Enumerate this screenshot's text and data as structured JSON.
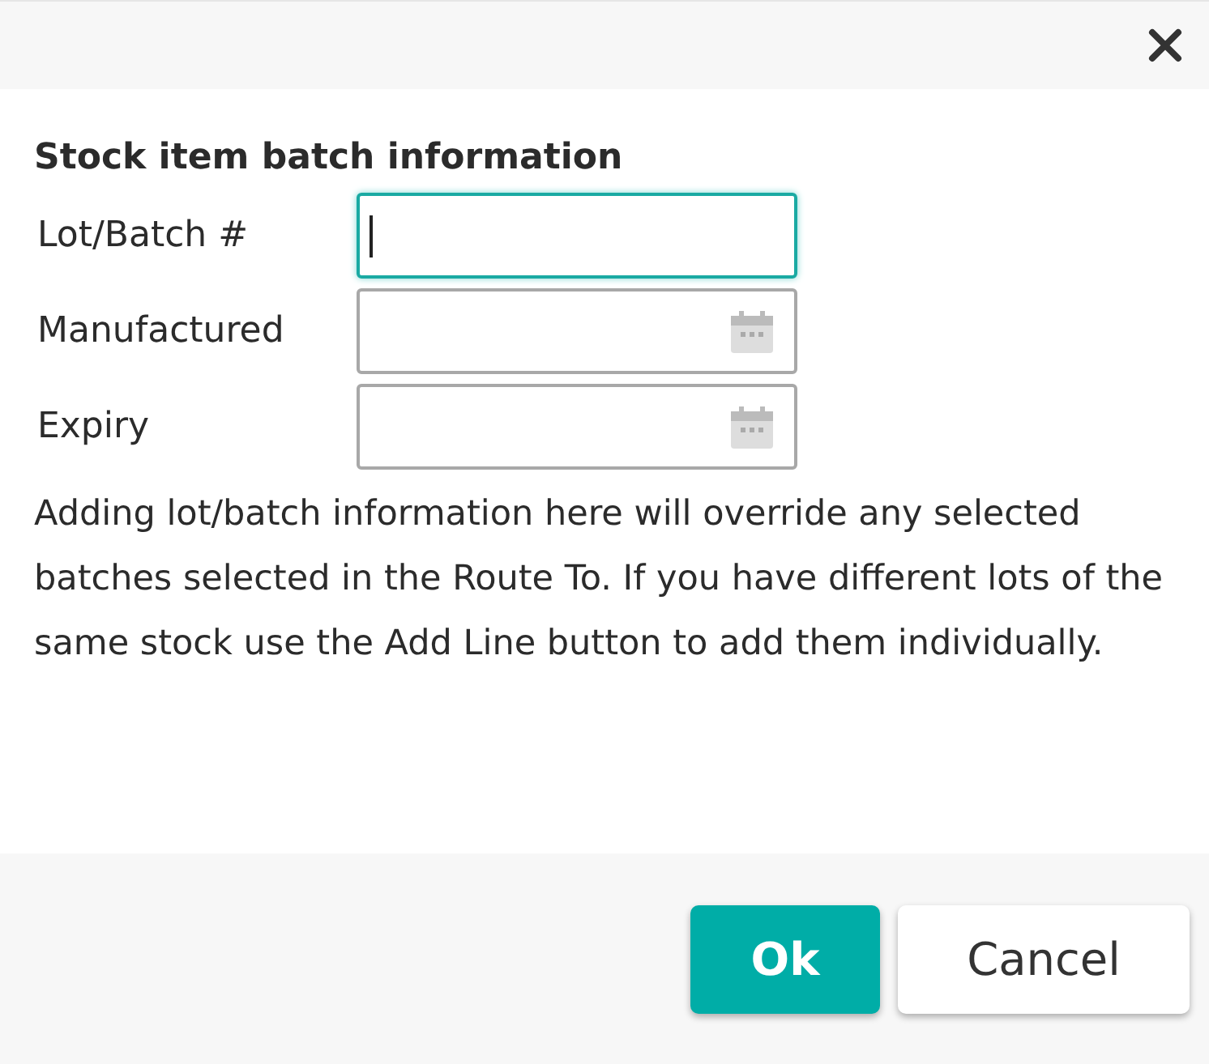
{
  "dialog": {
    "heading": "Stock item batch information",
    "fields": [
      {
        "label": "Lot/Batch #",
        "kind": "text",
        "focused": true
      },
      {
        "label": "Manufactured",
        "kind": "date",
        "focused": false
      },
      {
        "label": "Expiry",
        "kind": "date",
        "focused": false
      }
    ],
    "note": "Adding lot/batch information here will override any selected batches selected in the Route To. If you have different lots of the same stock use the Add Line button to add them individually.",
    "buttons": [
      {
        "label": "Ok",
        "kind": "primary"
      },
      {
        "label": "Cancel",
        "kind": "secondary"
      }
    ]
  }
}
